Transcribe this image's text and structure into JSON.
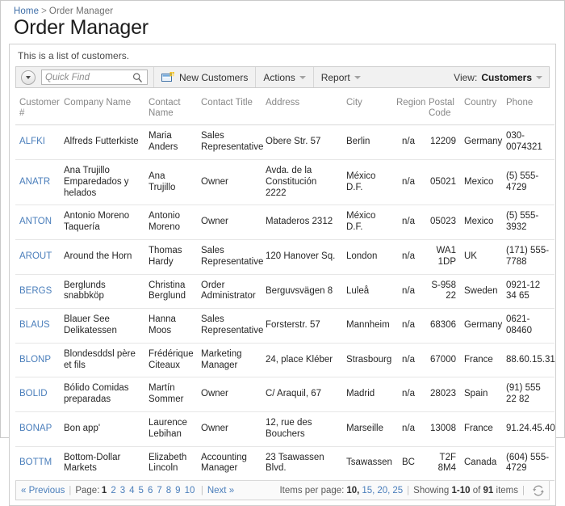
{
  "breadcrumb": {
    "home": "Home",
    "separator": ">",
    "current": "Order Manager"
  },
  "page_title": "Order Manager",
  "panel": {
    "description": "This is a list of customers."
  },
  "toolbar": {
    "expander_icon": "chevron-down-circle-icon",
    "quick_find_placeholder": "Quick Find",
    "quick_find_value": "",
    "search_icon": "magnifier-icon",
    "new_customers_label": "New Customers",
    "new_customers_icon": "new-window-icon",
    "actions_label": "Actions",
    "report_label": "Report",
    "view_label": "View:",
    "view_value": "Customers",
    "caret_icon": "chevron-down-icon"
  },
  "grid": {
    "columns": [
      "Customer #",
      "Company Name",
      "Contact Name",
      "Contact Title",
      "Address",
      "City",
      "Region",
      "Postal Code",
      "Country",
      "Phone"
    ],
    "rows": [
      {
        "id": "ALFKI",
        "company": "Alfreds Futterkiste",
        "contact": "Maria Anders",
        "title": "Sales Representative",
        "address": "Obere Str. 57",
        "city": "Berlin",
        "region": "n/a",
        "postal": "12209",
        "country": "Germany",
        "phone": "030-0074321"
      },
      {
        "id": "ANATR",
        "company": "Ana Trujillo Emparedados y helados",
        "contact": "Ana Trujillo",
        "title": "Owner",
        "address": "Avda. de la Constitución 2222",
        "city": "México D.F.",
        "region": "n/a",
        "postal": "05021",
        "country": "Mexico",
        "phone": "(5) 555-4729"
      },
      {
        "id": "ANTON",
        "company": "Antonio Moreno Taquería",
        "contact": "Antonio Moreno",
        "title": "Owner",
        "address": "Mataderos 2312",
        "city": "México D.F.",
        "region": "n/a",
        "postal": "05023",
        "country": "Mexico",
        "phone": "(5) 555-3932"
      },
      {
        "id": "AROUT",
        "company": "Around the Horn",
        "contact": "Thomas Hardy",
        "title": "Sales Representative",
        "address": "120 Hanover Sq.",
        "city": "London",
        "region": "n/a",
        "postal": "WA1 1DP",
        "country": "UK",
        "phone": "(171) 555-7788"
      },
      {
        "id": "BERGS",
        "company": "Berglunds snabbköp",
        "contact": "Christina Berglund",
        "title": "Order Administrator",
        "address": "Berguvsvägen 8",
        "city": "Luleå",
        "region": "n/a",
        "postal": "S-958 22",
        "country": "Sweden",
        "phone": "0921-12 34 65"
      },
      {
        "id": "BLAUS",
        "company": "Blauer See Delikatessen",
        "contact": "Hanna Moos",
        "title": "Sales Representative",
        "address": "Forsterstr. 57",
        "city": "Mannheim",
        "region": "n/a",
        "postal": "68306",
        "country": "Germany",
        "phone": "0621-08460"
      },
      {
        "id": "BLONP",
        "company": "Blondesddsl père et fils",
        "contact": "Frédérique Citeaux",
        "title": "Marketing Manager",
        "address": "24, place Kléber",
        "city": "Strasbourg",
        "region": "n/a",
        "postal": "67000",
        "country": "France",
        "phone": "88.60.15.31"
      },
      {
        "id": "BOLID",
        "company": "Bólido Comidas preparadas",
        "contact": "Martín Sommer",
        "title": "Owner",
        "address": "C/ Araquil, 67",
        "city": "Madrid",
        "region": "n/a",
        "postal": "28023",
        "country": "Spain",
        "phone": "(91) 555 22 82"
      },
      {
        "id": "BONAP",
        "company": "Bon app'",
        "contact": "Laurence Lebihan",
        "title": "Owner",
        "address": "12, rue des Bouchers",
        "city": "Marseille",
        "region": "n/a",
        "postal": "13008",
        "country": "France",
        "phone": "91.24.45.40"
      },
      {
        "id": "BOTTM",
        "company": "Bottom-Dollar Markets",
        "contact": "Elizabeth Lincoln",
        "title": "Accounting Manager",
        "address": "23 Tsawassen Blvd.",
        "city": "Tsawassen",
        "region": "BC",
        "postal": "T2F 8M4",
        "country": "Canada",
        "phone": "(604) 555-4729"
      }
    ]
  },
  "footer": {
    "previous_label": "« Previous",
    "page_label": "Page:",
    "pages": [
      "1",
      "2",
      "3",
      "4",
      "5",
      "6",
      "7",
      "8",
      "9",
      "10"
    ],
    "active_page": "1",
    "next_label": "Next »",
    "items_per_page_label": "Items per page:",
    "items_per_page_options": [
      "10",
      "15",
      "20",
      "25"
    ],
    "items_per_page_active": "10",
    "showing_label": "Showing",
    "showing_range": "1-10",
    "of_label": "of",
    "total_items": "91",
    "items_label": "items",
    "refresh_icon": "refresh-icon"
  },
  "colors": {
    "link": "#4a7ebb",
    "header_text": "#888888",
    "accent": "#3f6fa8"
  }
}
